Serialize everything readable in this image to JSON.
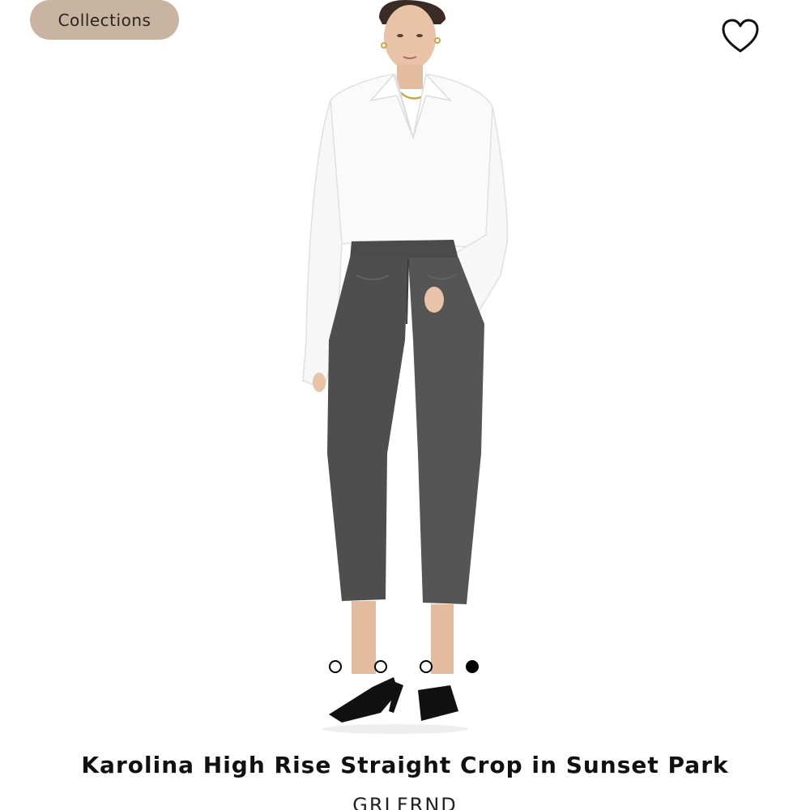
{
  "header": {
    "collections_label": "Collections",
    "favorite_icon": "heart-outline-icon"
  },
  "carousel": {
    "total": 4,
    "active_index": 3
  },
  "product": {
    "title": "Karolina High Rise Straight Crop in Sunset Park",
    "brand": "GRLFRND"
  },
  "colors": {
    "chip_background": "#c9b3a1",
    "text": "#111111",
    "denim": "#4a4a4a",
    "shirt": "#fafafa"
  }
}
